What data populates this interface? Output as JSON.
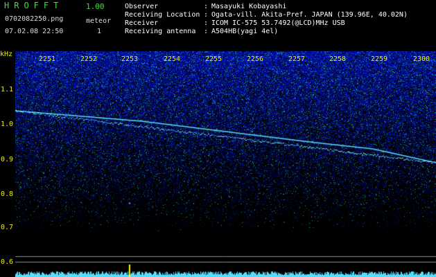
{
  "header": {
    "app_title": "HROFFT",
    "app_version": "1.00",
    "file_name": "0702082250.png",
    "date_time": "07.02.08 22:50",
    "meteor_label": "meteor",
    "meteor_count": "1"
  },
  "station_info": [
    {
      "key": "Observer",
      "value": "Masayuki Kobayashi"
    },
    {
      "key": "Receiving Location",
      "value": "Ogata-vill. Akita-Pref. JAPAN (139.96E, 40.02N)"
    },
    {
      "key": "Receiver",
      "value": "ICOM IC-575 53.7492(@LCD)MHz USB"
    },
    {
      "key": "Receiving antenna",
      "value": "A504HB(yagi 4el)"
    }
  ],
  "colors": {
    "background": "#000000",
    "label_yellow": "#f0f000",
    "title_green": "#3ee03e",
    "spectrum_noise": "#2233cc",
    "echo_trace": "#55ddff",
    "meteor_marker": "#ffff00"
  },
  "chart_data": {
    "type": "spectrogram",
    "y_unit": "kHz",
    "y_ticks": [
      "1.1",
      "1.0",
      "0.9",
      "0.8",
      "0.7",
      "0.6"
    ],
    "x_ticks": [
      "2251",
      "2252",
      "2253",
      "2254",
      "2255",
      "2256",
      "2257",
      "2258",
      "2259",
      "2300"
    ],
    "ylim": [
      0.58,
      1.18
    ],
    "x_range": [
      "2250",
      "2300"
    ],
    "echo_trace_khz": [
      {
        "x": 2250.0,
        "y": 1.04
      },
      {
        "x": 2253.0,
        "y": 1.01
      },
      {
        "x": 2255.0,
        "y": 0.98
      },
      {
        "x": 2257.0,
        "y": 0.95
      },
      {
        "x": 2258.5,
        "y": 0.93
      },
      {
        "x": 2300.0,
        "y": 0.89
      }
    ],
    "meteor_events": [
      {
        "x": "2252.7",
        "label": "meteor"
      }
    ],
    "reference_lines_khz": [
      0.62,
      0.605
    ]
  }
}
